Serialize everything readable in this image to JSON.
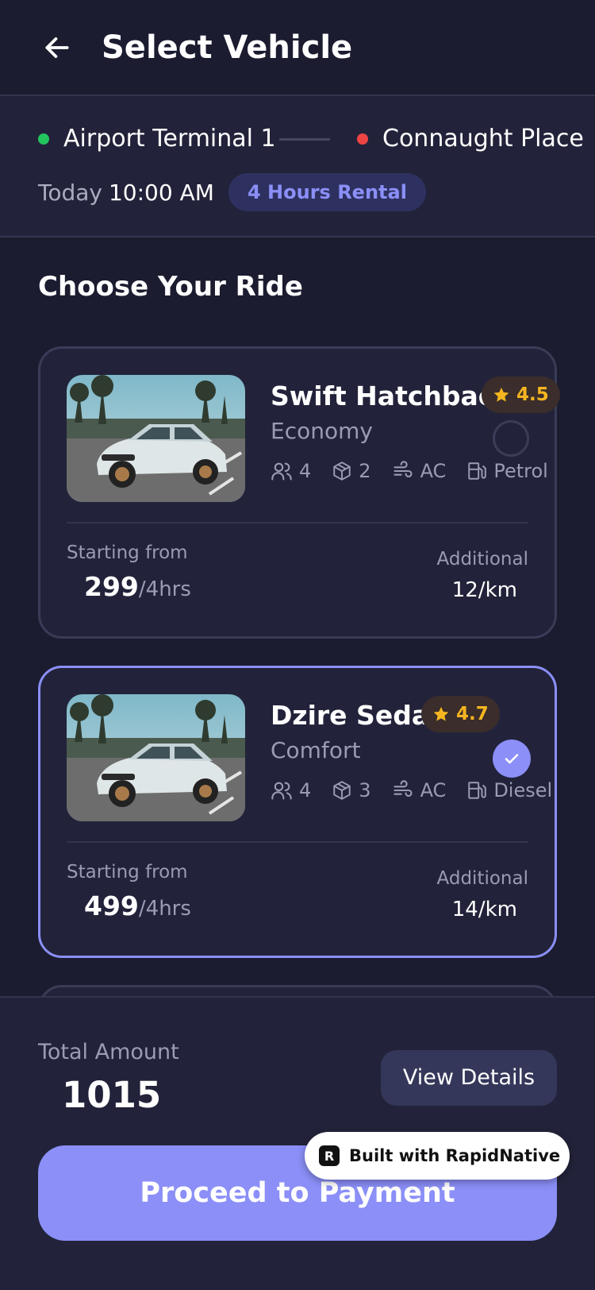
{
  "header": {
    "title": "Select Vehicle",
    "back_icon": "arrow-left-icon"
  },
  "trip": {
    "from": "Airport Terminal 1",
    "from_color": "#22c55e",
    "to": "Connaught Place",
    "to_color": "#ef4444",
    "day": "Today",
    "time": "10:00 AM",
    "rental": "4 Hours Rental"
  },
  "section_title": "Choose Your Ride",
  "vehicles": [
    {
      "name": "Swift Hatchback",
      "rating": "4.5",
      "class": "Economy",
      "seats": "4",
      "bags": "2",
      "ac": "AC",
      "fuel": "Petrol",
      "from_label": "Starting from",
      "price": "299",
      "per": "/4hrs",
      "additional_label": "Additional",
      "additional": "12/km",
      "selected": false
    },
    {
      "name": "Dzire Sedan",
      "rating": "4.7",
      "class": "Comfort",
      "seats": "4",
      "bags": "3",
      "ac": "AC",
      "fuel": "Diesel",
      "from_label": "Starting from",
      "price": "499",
      "per": "/4hrs",
      "additional_label": "Additional",
      "additional": "14/km",
      "selected": true
    }
  ],
  "footer": {
    "total_label": "Total Amount",
    "total": "1015",
    "details_label": "View Details",
    "pay_label": "Proceed to Payment"
  },
  "badge": {
    "text": "Built with RapidNative"
  },
  "colors": {
    "accent": "#8b8ff7",
    "background": "#1b1c30",
    "card": "#22233a",
    "star": "#f5b51f"
  }
}
